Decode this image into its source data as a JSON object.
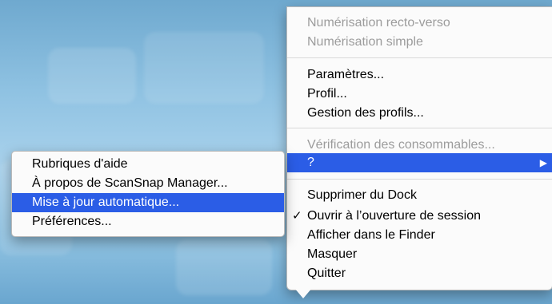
{
  "main_menu": {
    "scan_duplex": "Numérisation recto-verso",
    "scan_simplex": "Numérisation simple",
    "settings": "Paramètres...",
    "profile": "Profil...",
    "profile_management": "Gestion des profils...",
    "consumables_check": "Vérification des consommables...",
    "help": "?",
    "help_arrow": "▶",
    "remove_from_dock": "Supprimer du Dock",
    "open_at_login": "Ouvrir à l’ouverture de session",
    "open_at_login_check": "✓",
    "show_in_finder": "Afficher dans le Finder",
    "hide": "Masquer",
    "quit": "Quitter"
  },
  "help_submenu": {
    "help_topics": "Rubriques d'aide",
    "about": "À propos de ScanSnap Manager...",
    "auto_update": "Mise à jour automatique...",
    "preferences": "Préférences..."
  },
  "colors": {
    "selection": "#2b5de6",
    "disabled_text": "#9c9c9c"
  }
}
